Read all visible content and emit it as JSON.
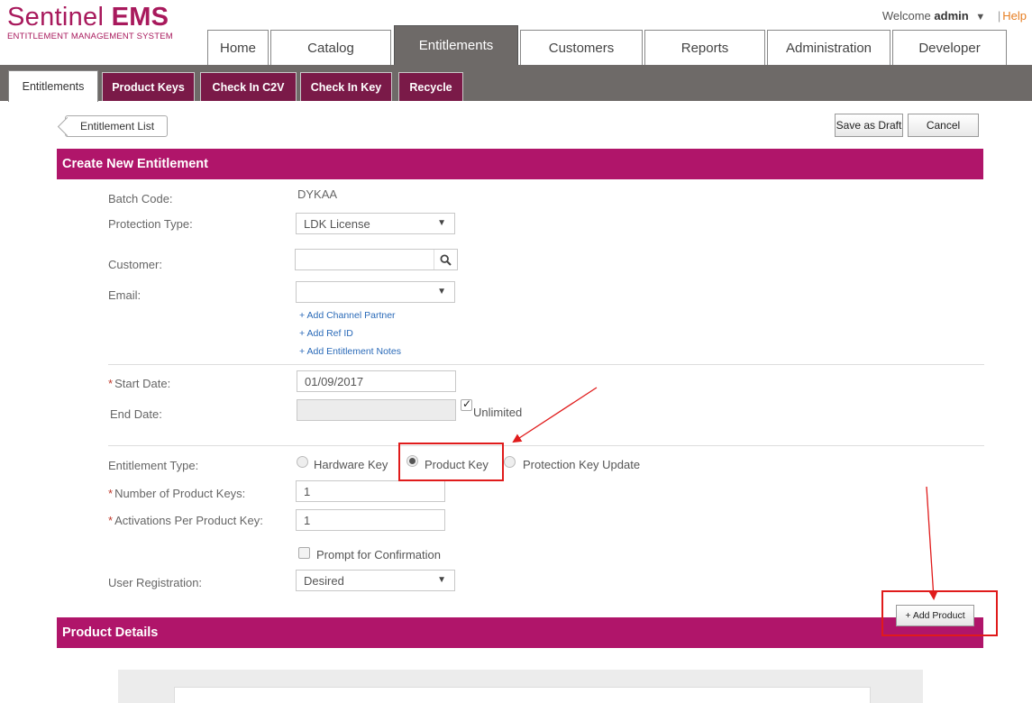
{
  "brand": {
    "name_light": "Sentinel",
    "name_bold": "EMS",
    "subtitle": "ENTITLEMENT MANAGEMENT SYSTEM"
  },
  "header": {
    "welcome_prefix": "Welcome",
    "user": "admin",
    "user_caret": "▼",
    "separator": "|",
    "help": "Help"
  },
  "main_tabs": [
    "Home",
    "Catalog",
    "Entitlements",
    "Customers",
    "Reports",
    "Administration",
    "Developer"
  ],
  "sub_tabs": [
    "Entitlements",
    "Product Keys",
    "Check In C2V",
    "Check In Key",
    "Recycle"
  ],
  "toolbar": {
    "back_label": "Entitlement List",
    "save_draft": "Save as Draft",
    "cancel": "Cancel"
  },
  "form": {
    "header": "Create New Entitlement",
    "batch_code_label": "Batch Code:",
    "batch_code_value": "DYKAA",
    "protection_type_label": "Protection Type:",
    "protection_type_value": "LDK License",
    "customer_label": "Customer:",
    "customer_value": "",
    "email_label": "Email:",
    "email_value": "",
    "links": [
      "+ Add Channel Partner",
      "+ Add Ref ID",
      "+ Add Entitlement Notes"
    ],
    "required_mark": "*",
    "start_date_label": "Start Date:",
    "start_date_value": "01/09/2017",
    "end_date_label": "End Date:",
    "end_date_value": "",
    "unlimited_label": "Unlimited",
    "entitlement_type_label": "Entitlement Type:",
    "entitlement_types": [
      "Hardware Key",
      "Product Key",
      "Protection Key Update"
    ],
    "selected_type": "Product Key",
    "num_keys_label": "Number of Product Keys:",
    "num_keys_value": "1",
    "activations_label": "Activations Per Product Key:",
    "activations_value": "1",
    "prompt_label": "Prompt for Confirmation",
    "user_registration_label": "User Registration:",
    "user_registration_value": "Desired",
    "dropdown_caret": "▼"
  },
  "product_details": {
    "header": "Product Details",
    "add_product": "+ Add Product"
  },
  "colors": {
    "brand": "#a8195c",
    "section_header": "#b0156a",
    "subtab": "#7a1a48",
    "nav_dark": "#6e6a68",
    "annotation": "#e01b1b",
    "link": "#2a6ab8"
  }
}
